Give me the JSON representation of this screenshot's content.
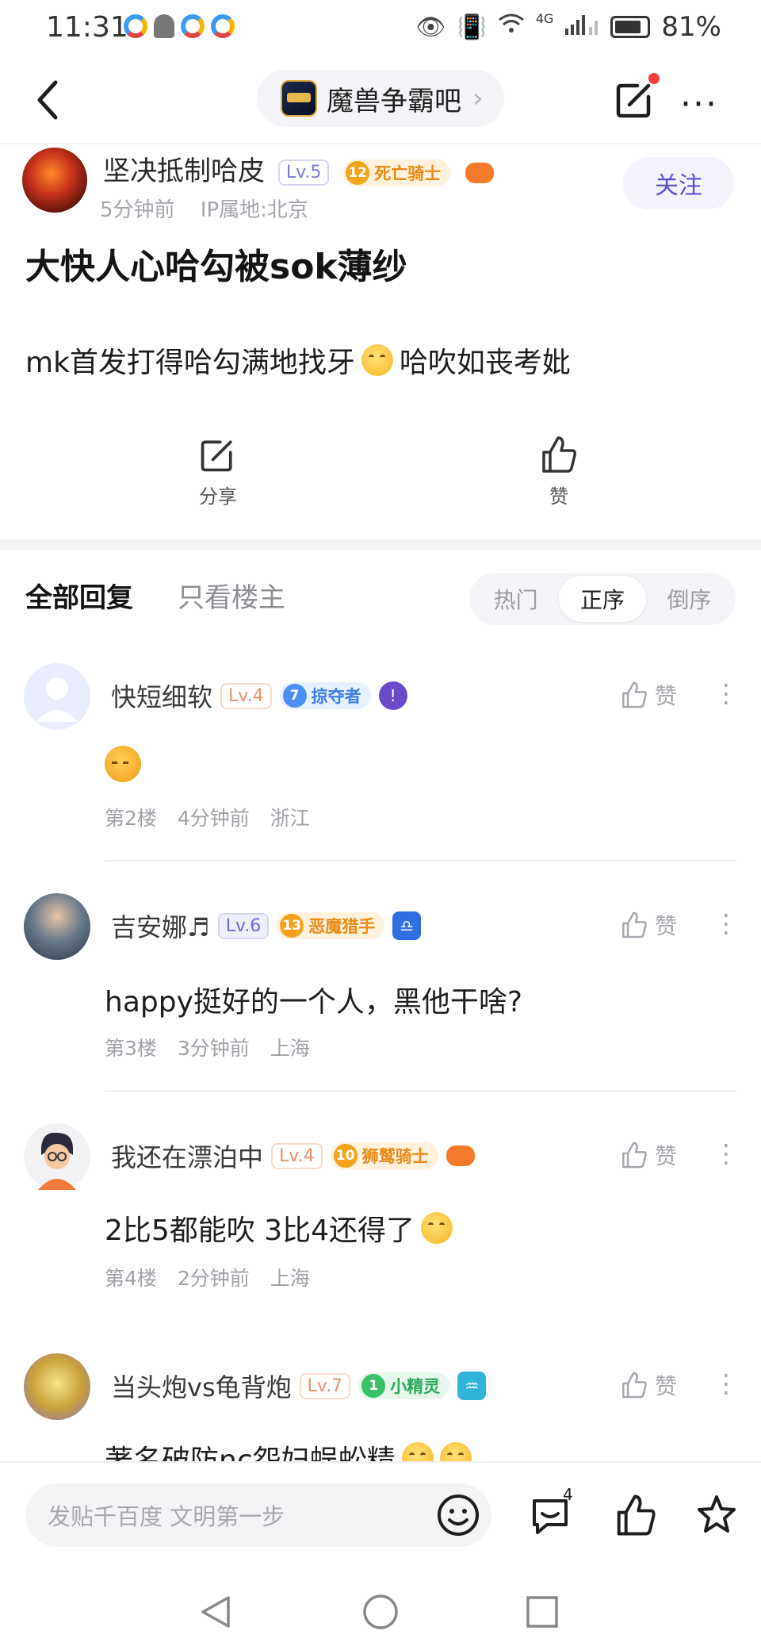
{
  "status_bar": {
    "time": "11:31",
    "battery": "81%",
    "network": "4G"
  },
  "nav": {
    "forum_name": "魔兽争霸吧"
  },
  "post": {
    "author": "坚决抵制哈皮",
    "level": "Lv.5",
    "badge_num": "12",
    "badge_title": "死亡骑士",
    "time": "5分钟前",
    "ip": "IP属地:北京",
    "follow": "关注",
    "title": "大快人心哈勾被sok薄纱",
    "body_pre": "mk首发打得哈勾满地找牙",
    "body_post": "哈吹如丧考妣",
    "share_label": "分享",
    "like_label": "赞"
  },
  "replies_header": {
    "tab_all": "全部回复",
    "tab_op": "只看楼主",
    "sort": [
      "热门",
      "正序",
      "倒序"
    ]
  },
  "comments": [
    {
      "name": "快短细软",
      "level": "Lv.4",
      "badge_num": "7",
      "badge_title": "掠夺者",
      "text": "",
      "floor": "第2楼",
      "time": "4分钟前",
      "location": "浙江",
      "like": "赞"
    },
    {
      "name": "吉安娜♬",
      "level": "Lv.6",
      "badge_num": "13",
      "badge_title": "恶魔猎手",
      "text": "happy挺好的一个人，黑他干啥?",
      "floor": "第3楼",
      "time": "3分钟前",
      "location": "上海",
      "like": "赞"
    },
    {
      "name": "我还在漂泊中",
      "level": "Lv.4",
      "badge_num": "10",
      "badge_title": "狮鹫骑士",
      "text": "2比5都能吹 3比4还得了",
      "floor": "第4楼",
      "time": "2分钟前",
      "location": "上海",
      "like": "赞"
    },
    {
      "name": "当头炮vs龟背炮",
      "level": "Lv.7",
      "badge_num": "1",
      "badge_title": "小精灵",
      "text": "著名破防nc怨妇蜈蚣精",
      "like": "赞"
    }
  ],
  "bottom_bar": {
    "placeholder": "发贴千百度 文明第一步",
    "comment_count": "4"
  },
  "colors": {
    "accent": "#5b4fd0",
    "background": "#ffffff",
    "muted": "#a0a0a8"
  }
}
